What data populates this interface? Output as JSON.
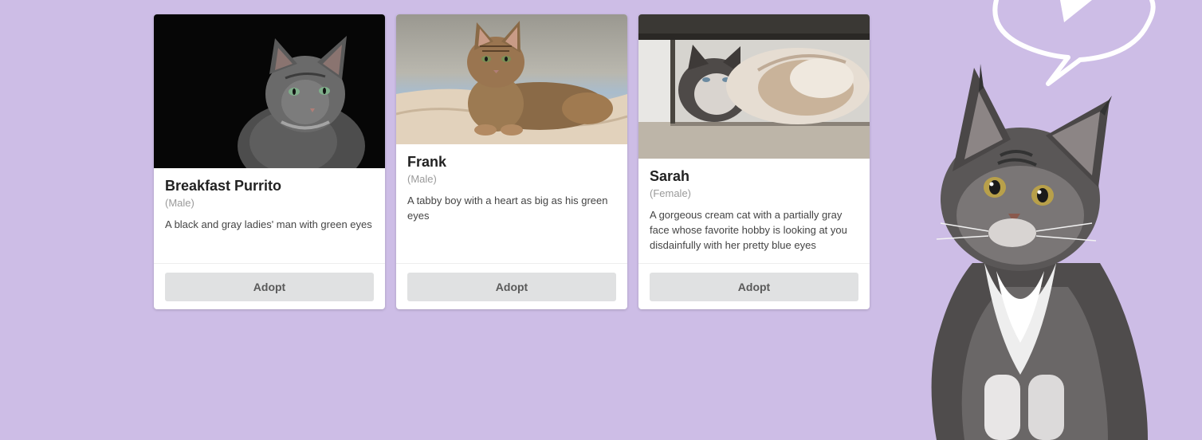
{
  "cats": [
    {
      "name": "Breakfast Purrito",
      "gender": "(Male)",
      "description": "A black and gray ladies' man with green eyes",
      "photo": "gray-tabby-cat-on-black-background-photo",
      "adopt_label": "Adopt"
    },
    {
      "name": "Frank",
      "gender": "(Male)",
      "description": "A tabby boy with a heart as big as his green eyes",
      "photo": "brown-tabby-cat-lying-on-blanket-photo",
      "adopt_label": "Adopt"
    },
    {
      "name": "Sarah",
      "gender": "(Female)",
      "description": "A gorgeous cream cat with a partially gray face whose favorite hobby is looking at you disdainfully with her pretty blue eyes",
      "photo": "fluffy-cream-cat-under-bench-photo",
      "adopt_label": "Adopt"
    }
  ],
  "mascot": {
    "image": "maine-coon-kitten-with-speech-bubble-illustration"
  },
  "colors": {
    "background": "#cdbde6",
    "card": "#ffffff",
    "button": "#e0e1e2"
  }
}
